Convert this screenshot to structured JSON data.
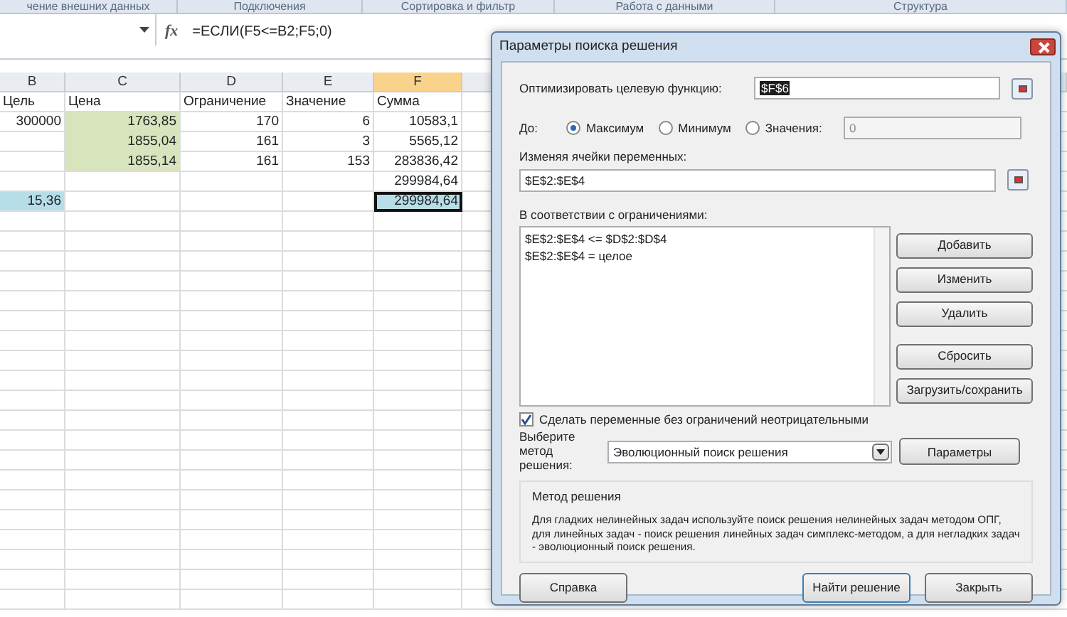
{
  "ribbon_groups": [
    "чение внешних данных",
    "Подключения",
    "Сортировка и фильтр",
    "Работа с данными",
    "Структура"
  ],
  "formula_bar": {
    "function_label": "fx",
    "formula": "=ЕСЛИ(F5<=B2;F5;0)"
  },
  "columns": [
    {
      "label": "B",
      "selected": false
    },
    {
      "label": "C",
      "selected": false
    },
    {
      "label": "D",
      "selected": false
    },
    {
      "label": "E",
      "selected": false
    },
    {
      "label": "F",
      "selected": true
    }
  ],
  "rows": [
    [
      {
        "text": "Цель",
        "kind": "text"
      },
      {
        "text": "Цена",
        "kind": "text"
      },
      {
        "text": "Ограничение",
        "kind": "text"
      },
      {
        "text": "Значение",
        "kind": "text"
      },
      {
        "text": "Сумма",
        "kind": "text"
      }
    ],
    [
      {
        "text": "300000",
        "kind": "number"
      },
      {
        "text": "1763,85",
        "kind": "number",
        "color": "#d8e4bc"
      },
      {
        "text": "170",
        "kind": "number"
      },
      {
        "text": "6",
        "kind": "number"
      },
      {
        "text": "10583,1",
        "kind": "number"
      }
    ],
    [
      {
        "kind": "empty"
      },
      {
        "text": "1855,04",
        "kind": "number",
        "color": "#d8e4bc"
      },
      {
        "text": "161",
        "kind": "number"
      },
      {
        "text": "3",
        "kind": "number"
      },
      {
        "text": "5565,12",
        "kind": "number"
      }
    ],
    [
      {
        "kind": "empty"
      },
      {
        "text": "1855,14",
        "kind": "number",
        "color": "#d8e4bc"
      },
      {
        "text": "161",
        "kind": "number"
      },
      {
        "text": "153",
        "kind": "number"
      },
      {
        "text": "283836,42",
        "kind": "number"
      }
    ],
    [
      {
        "kind": "empty"
      },
      {
        "kind": "empty"
      },
      {
        "kind": "empty"
      },
      {
        "kind": "empty"
      },
      {
        "text": "299984,64",
        "kind": "number"
      }
    ],
    [
      {
        "text": "15,36",
        "kind": "number",
        "color": "#b7dee8"
      },
      {
        "kind": "empty"
      },
      {
        "kind": "empty"
      },
      {
        "kind": "empty"
      },
      {
        "text": "299984,64",
        "kind": "number",
        "color": "#b7dee8",
        "selected": true
      }
    ]
  ],
  "dialog": {
    "title": "Параметры поиска решения",
    "objective_label": "Оптимизировать целевую функцию:",
    "objective_value": "$F$6",
    "to_label": "До:",
    "radios": [
      {
        "label": "Максимум",
        "selected": true
      },
      {
        "label": "Минимум",
        "selected": false
      },
      {
        "label": "Значения:",
        "selected": false
      }
    ],
    "value_field": {
      "value": "0",
      "disabled": true
    },
    "variables_label": "Изменяя ячейки переменных:",
    "variables_value": "$E$2:$E$4",
    "constraints_label": "В соответствии с ограничениями:",
    "constraints": [
      "$E$2:$E$4 <= $D$2:$D$4",
      "$E$2:$E$4 = целое"
    ],
    "side_buttons": [
      "Добавить",
      "Изменить",
      "Удалить",
      "Сбросить",
      "Загрузить/сохранить"
    ],
    "nonnegative": {
      "label": "Сделать переменные без ограничений неотрицательными",
      "checked": true
    },
    "method_label": "Выберите метод решения:",
    "method_value": "Эволюционный поиск решения",
    "params_button": "Параметры",
    "method_group_title": "Метод решения",
    "method_description": "Для гладких нелинейных задач используйте поиск решения нелинейных задач методом ОПГ, для линейных задач - поиск решения линейных задач симплекс-методом, а для негладких задач - эволюционный поиск решения.",
    "footer_buttons": [
      "Справка",
      "Найти решение",
      "Закрыть"
    ]
  }
}
